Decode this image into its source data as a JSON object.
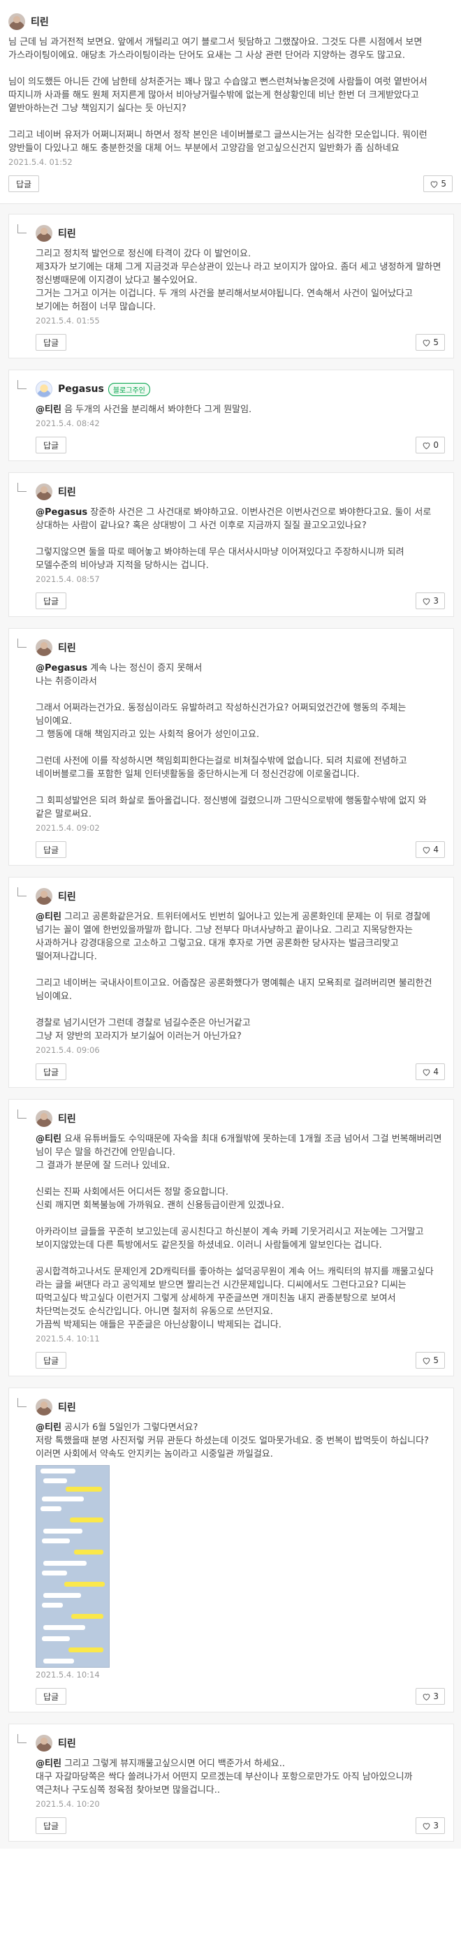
{
  "main": {
    "nickname": "티린",
    "paragraphs": [
      "님 근데 님 과거전적 보면요. 앞에서 개털리고 여기 블로그서 뒷담하고 그랬잖아요. 그것도 다른 시점에서 보면 가스라이팅이에요. 애당초 가스라이팅이라는 단어도 요새는 그 사상 관련 단어라 지양하는 경우도 많고요.",
      "님이 의도했든 아니든 간에 남한테 상처준거는 꽤나 많고 수습않고 뻔스런쳐놔놓은것에 사람들이 여럿 옅반어서 따지니까 사과를 해도 원체 저지른게 많아서 비아냥거릴수밖에 없는게 현상황인데 비난 한번 더 크게받았다고 옅반아하는건 그냥 책임지기 싫다는 듯 아닌지?",
      "그리고 네이버 유저가 어쩌니저쩌니 하면서 정작 본인은 네이버블로그 글쓰시는거는 심각한 모순입니다. 뭐이런 양반들이 다있나고 해도 충분한것을 대체 어느 부분에서 고양감을 얻고싶으신건지 일반화가 좀 심하네요"
    ],
    "date": "2021.5.4. 01:52",
    "reply_label": "답글",
    "likes": "5"
  },
  "replies": [
    {
      "nickname": "티린",
      "mention": "",
      "paragraphs": [
        "그리고 정치적 발언으로 정신에 타격이 갔다 이 발언이요.\n제3자가 보기에는 대체 그게 지금것과 무슨상관이 있는나 라고 보이지가 않아요. 좀더 세고 냉정하게 말하면 정신병때문에 이지경이 났다고 볼수있어요.\n그거는 그거고 이거는 이겁니다. 두 개의 사건을 분리해서보셔야됩니다. 연속해서 사건이 일어났다고 보기에는 허점이 너무 많습니다."
      ],
      "date": "2021.5.4. 01:55",
      "likes": "5"
    },
    {
      "nickname": "Pegasus",
      "badge": "블로그주인",
      "mention": "@티린",
      "paragraphs": [
        "음 두개의 사건을 분리해서 봐야한다 그게 뭔말임."
      ],
      "date": "2021.5.4. 08:42",
      "likes": "0"
    },
    {
      "nickname": "티린",
      "mention": "@Pegasus",
      "paragraphs": [
        "장준하 사건은 그 사건대로 봐야하고요. 이번사건은 이번사건으로 봐야한다고요. 둘이 서로 상대하는 사람이 같나요? 혹은 상대방이 그 사건 이후로 지금까지 질질 끌고오고있나요?",
        "그렇지않으면 둘을 따로 떼어놓고 봐야하는데 무슨 대서사시마냥 이어져있다고 주장하시니까 되려 모델수준의 비아냥과 지적을 당하시는 겁니다."
      ],
      "date": "2021.5.4. 08:57",
      "likes": "3"
    },
    {
      "nickname": "티린",
      "mention": "@Pegasus",
      "paragraphs": [
        "계속 나는 정신이 증지 못해서\n나는 취증이라서",
        "그래서 어쩌라는건가요. 동정심이라도 유발하려고 작성하신건가요? 어쩌되었건간에 행동의 주체는 님이예요.\n그 행동에 대해 책임지라고 있는 사회적 용어가 성인이고요.",
        "그런데 사전에 이를 작성하시면 책임회피한다는걸로 비쳐질수밖에 없습니다. 되려 치료에 전념하고 네이버블로그를 포함한 일체 인터넷활동을 중단하시는게 더 정신건강에 이로울겁니다.",
        "그 회피성발언은 되려 화살로 돌아올겁니다. 정신병에 걸렸으니까 그딴식으로밖에 행동할수밖에 없지 와 같은 말로써요."
      ],
      "date": "2021.5.4. 09:02",
      "likes": "4"
    },
    {
      "nickname": "티린",
      "mention": "@티린",
      "paragraphs": [
        "그리고 공론화같은거요. 트위터에서도 빈번히 일어나고 있는게 공론화인데 문제는 이 뒤로 경찰에 넘기는 꼴이 열에 한번있을까말까 합니다. 그냥 전부다 마녀사냥하고 끝이나요. 그리고 지목당한자는 사과하거나 강경대응으로 고소하고 그렇고요. 대개 후자로 가면 공론화한 당사자는 벌금크리맞고 떨어져나갑니다.",
        "그리고 네이버는 국내사이트이고요. 어줍잖은 공론화했다가 명예훼손 내지 모욕죄로 걸려버리면 불리한건 님이예요.",
        "경찰로 넘기시던가 그런데 경찰로 넘길수준은 아닌거같고\n그냥 저 양반의 꼬라지가 보기싫어 이러는거 아닌가요?"
      ],
      "date": "2021.5.4. 09:06",
      "likes": "4"
    },
    {
      "nickname": "티린",
      "mention": "@티린",
      "paragraphs": [
        "요새 유튜버들도 수익때문에 자숙을 최대 6개월밖에 못하는데 1개월 조금 넘어서 그걸 번복해버리면 님이 무슨 말을 하건간에 안믿습니다.\n그 결과가 분문에 잘 드러나 있네요.",
        "신뢰는 진짜 사회에서든 어디서든 정말 중요합니다.\n신뢰 깨지면 회복불능에 가까워요. 괜히 신용등급이란게 있겠나요.",
        "아카라이브 글들을 꾸준히 보고있는데 공시친다고 하신분이 계속 카페 기웃거리시고 저눈에는 그거말고 보이지않았는데 다른 특방에서도 같은짓을 하셨네요. 이러니 사람들에게 알보인다는 겁니다.",
        "공시합격하고나서도 문제인게 2D캐릭터를 좋아하는 설덕공무원이 계속 어느 캐릭터의 뷰지를 깨물고싶다 라는 글을 써댄다 라고 공익제보 받으면 짤리는건 시간문제입니다. 디씨에서도 그런다고요? 디씨는 따먹고싶다 박고싶다 이런거지 그렇게 상세하게 꾸준글쓰면 개미친놈 내지 관종분탕으로 보여서 차단먹는것도 순식간입니다. 아니면 철저히 유동으로 쓰던지요.\n가끔씩 박제되는 애들은 꾸준글은 아닌상황이니 박제되는 겁니다."
      ],
      "date": "2021.5.4. 10:11",
      "likes": "5"
    },
    {
      "nickname": "티린",
      "mention": "@티린",
      "paragraphs": [
        "공시가 6월 5일인가 그렇다면서요?\n저랑 톡했을때 분명 사진저렇 커뮤 관둔다 하셨는데 이것도 얼마못가네요. 중 번복이 밥먹듯이 하십니다? 이러면 사회에서 약속도 안지키는 놈이라고 시중일관 까일걸요."
      ],
      "has_image": true,
      "date": "2021.5.4. 10:14",
      "likes": "3"
    },
    {
      "nickname": "티린",
      "mention": "@티린",
      "paragraphs": [
        "그리고 그렇게 뷰지깨물고싶으시면 어디 백준가서 하세요..\n대구 자갈마당쪽은 싹다 쓸려나가서 어떤지 모르겠는데 부산이나 포항으로만가도 아직 남아있으니까 역근처나 구도심쪽 정육점 찾아보면 많을겁니다.."
      ],
      "date": "2021.5.4. 10:20",
      "likes": "3"
    }
  ]
}
